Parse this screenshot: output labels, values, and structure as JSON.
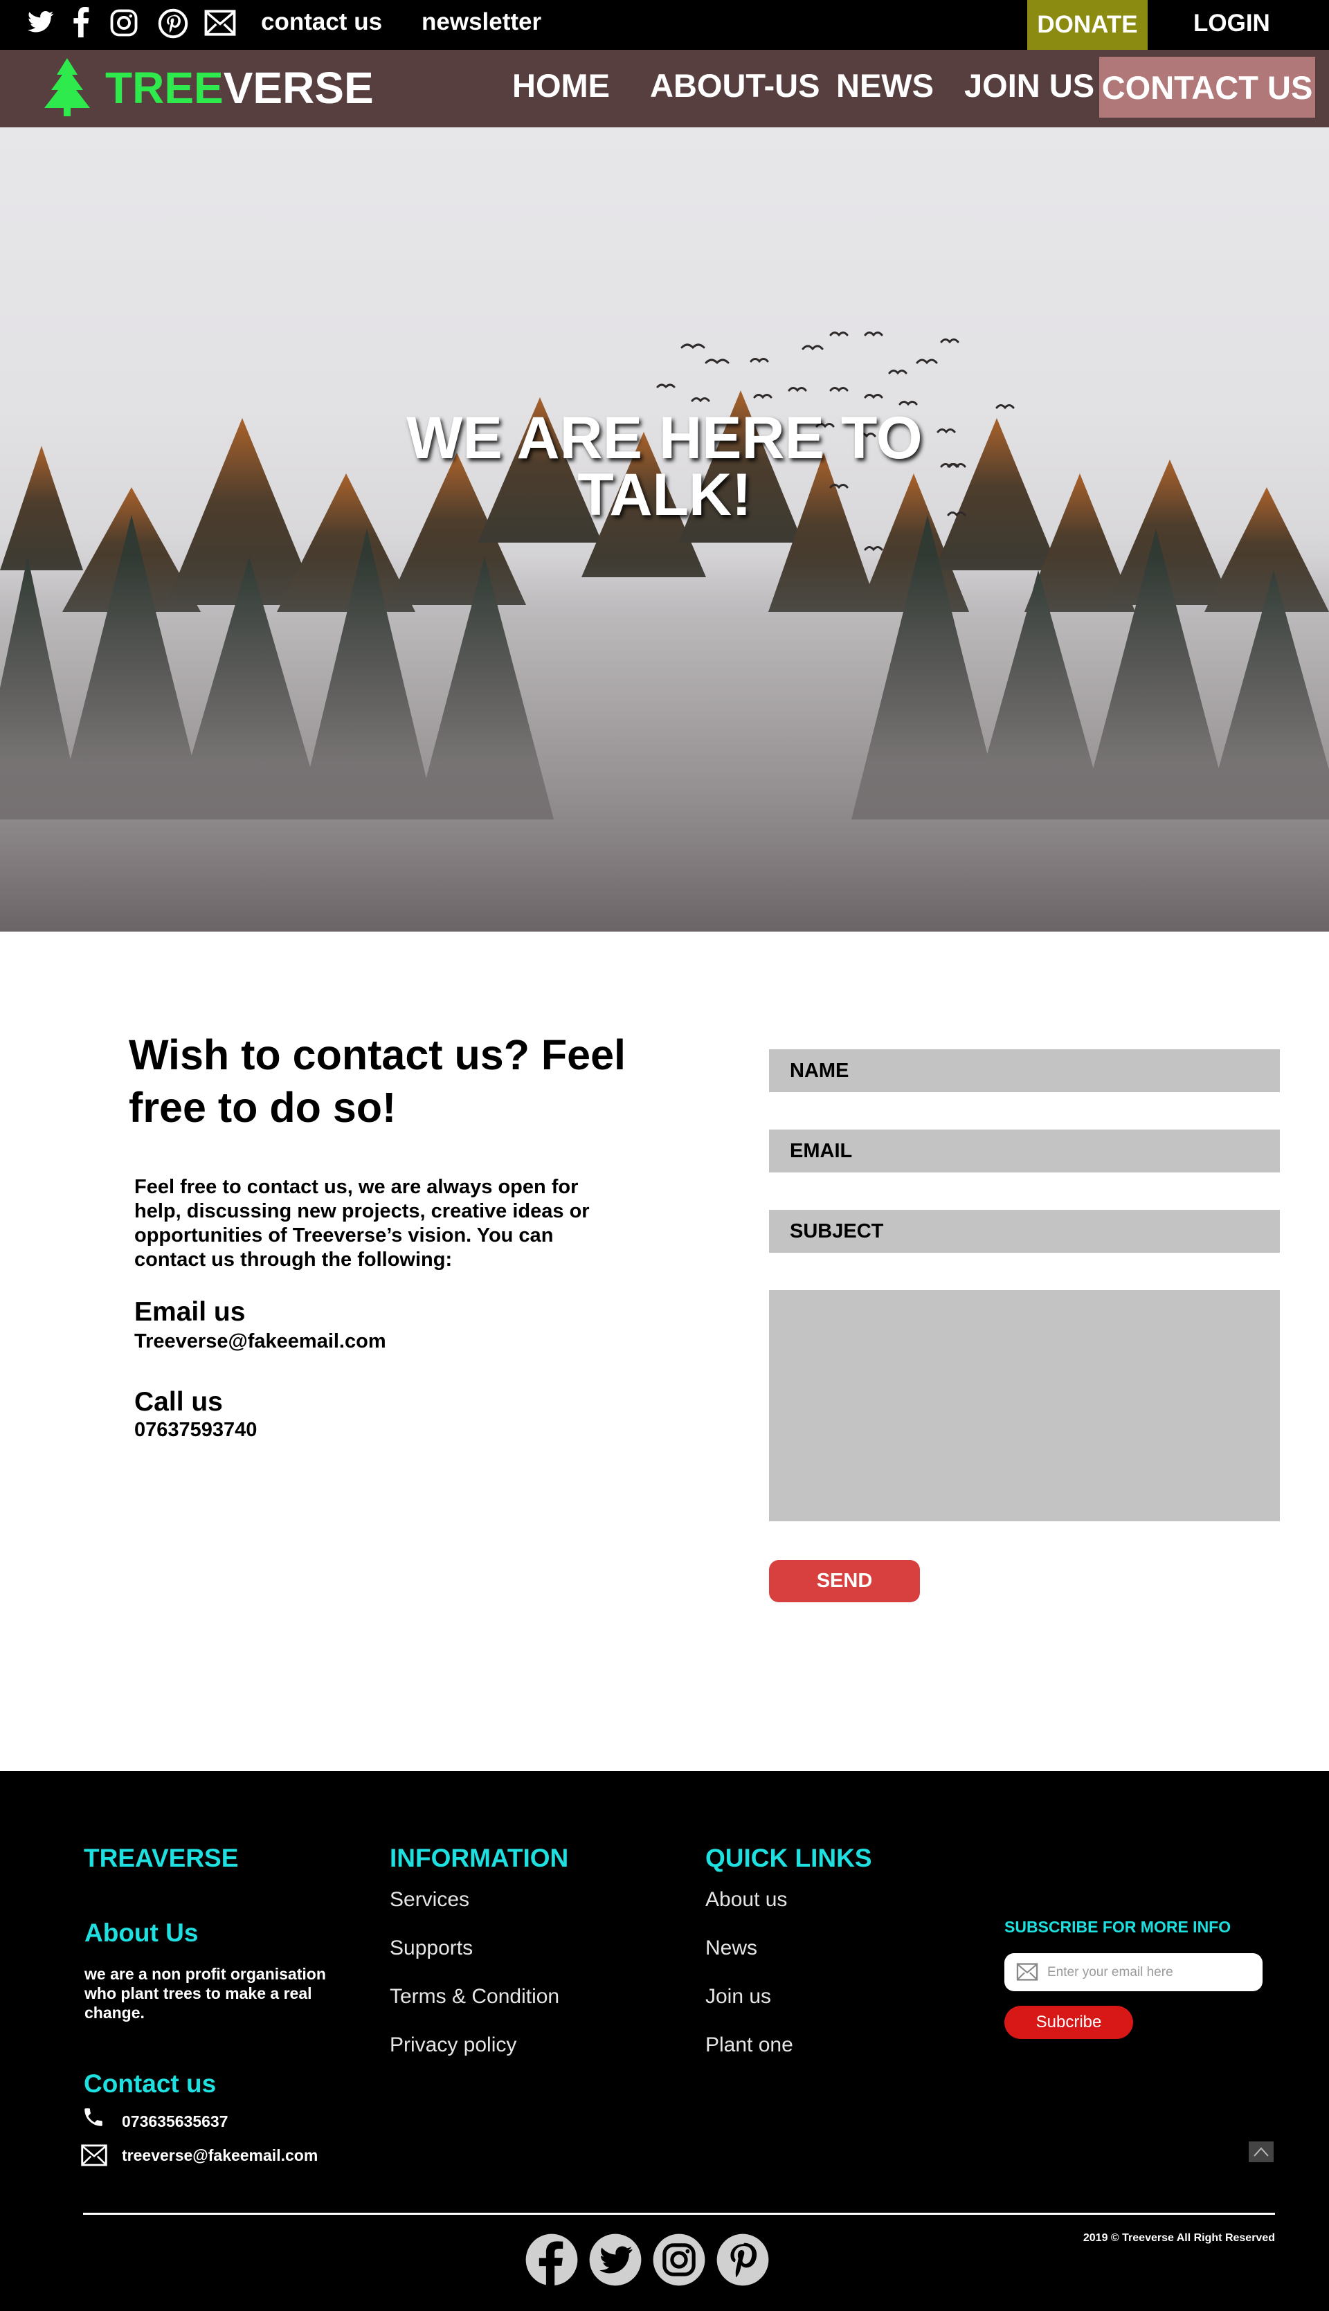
{
  "topbar": {
    "social_icons": [
      "twitter-icon",
      "facebook-icon",
      "instagram-icon",
      "pinterest-icon",
      "mail-icon"
    ],
    "links": {
      "contact": "contact us",
      "newsletter": "newsletter"
    },
    "donate": "DONATE",
    "login": "LOGIN"
  },
  "nav": {
    "logo_green": "TREE",
    "logo_white": "VERSE",
    "items": [
      "HOME",
      "ABOUT-US",
      "NEWS",
      "JOIN US",
      "CONTACT US"
    ],
    "active": "CONTACT US"
  },
  "hero": {
    "title_line1": "WE ARE HERE TO",
    "title_line2": "TALK!"
  },
  "contact": {
    "heading_line1": "Wish to contact us? Feel",
    "heading_line2": "free to do so!",
    "intro": [
      "Feel free to contact us, we are always open for",
      "help, discussing new projects, creative ideas or",
      "opportunities of Treeverse’s vision. You can",
      "contact us through the following:"
    ],
    "email_label": "Email us",
    "email_value": "Treeverse@fakeemail.com",
    "call_label": "Call us",
    "call_value": "07637593740"
  },
  "form": {
    "name": "NAME",
    "email": "EMAIL",
    "subject": "SUBJECT",
    "message": "",
    "send": "SEND"
  },
  "footer": {
    "brand": "TREAVERSE",
    "about_heading": "About Us",
    "about_lines": [
      "we are a non profit organisation",
      "who plant trees to make a real",
      "change."
    ],
    "contact_heading": "Contact us",
    "phone": "073635635637",
    "email": "treeverse@fakeemail.com",
    "information_heading": "INFORMATION",
    "information_links": [
      "Services",
      "Supports",
      "Terms & Condition",
      "Privacy policy"
    ],
    "quick_heading": "QUICK LINKS",
    "quick_links": [
      "About us",
      "News",
      "Join us",
      "Plant one"
    ],
    "subscribe_heading": "SUBSCRIBE FOR MORE INFO",
    "subscribe_placeholder": "Enter your email here",
    "subscribe_button": "Subcribe",
    "bottom_social": [
      "facebook-icon",
      "twitter-icon",
      "instagram-icon",
      "pinterest-icon"
    ],
    "copyright": "2019 © Treeverse All Right Reserved"
  },
  "colors": {
    "topbar_bg": "#000000",
    "nav_bg": "#573f3f",
    "donate_bg": "#8b8a11",
    "active_nav_bg": "#b07878",
    "logo_green": "#2eea4c",
    "form_field_bg": "#c3c3c3",
    "send_bg": "#d83f3f",
    "footer_heading": "#1fe0e0",
    "subscribe_btn": "#d81717"
  }
}
